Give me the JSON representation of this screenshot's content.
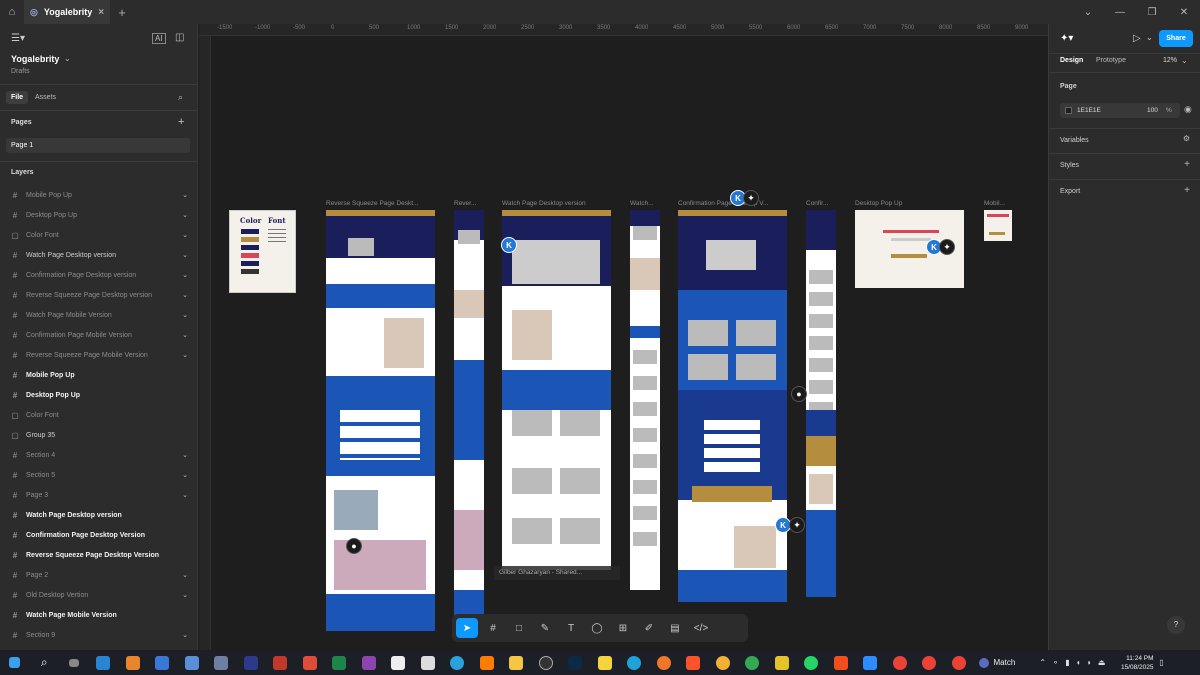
{
  "tabbar": {
    "tab_title": "Yogalebrity",
    "close": "×",
    "new_tab": "+",
    "window": [
      "—",
      "❐",
      "✕"
    ],
    "min_label": "⌄"
  },
  "left_panel": {
    "project": "Yogalebrity",
    "subtitle": "Drafts",
    "tab_file": "File",
    "tab_assets": "Assets",
    "pages_label": "Pages",
    "page_item": "Page 1",
    "layers_label": "Layers",
    "layers": [
      {
        "name": "Mobile Pop Up",
        "type": "frame",
        "style": "dim",
        "chev": true
      },
      {
        "name": "Desktop Pop Up",
        "type": "frame",
        "style": "dim",
        "chev": true
      },
      {
        "name": "Color Font",
        "type": "box",
        "style": "dim",
        "chev": true
      },
      {
        "name": "Watch Page Desktop version",
        "type": "frame",
        "style": "normal",
        "chev": true
      },
      {
        "name": "Confirmation Page Desktop version",
        "type": "frame",
        "style": "dim",
        "chev": true
      },
      {
        "name": "Reverse Squeeze Page Desktop version",
        "type": "frame",
        "style": "dim",
        "chev": true
      },
      {
        "name": "Watch  Page  Mobile Version",
        "type": "frame",
        "style": "dim",
        "chev": true
      },
      {
        "name": "Confirmation  Page  Mobile Version",
        "type": "frame",
        "style": "dim",
        "chev": true
      },
      {
        "name": "Reverse Squeeze Page  Mobile Version",
        "type": "frame",
        "style": "dim",
        "chev": true
      },
      {
        "name": "Mobile Pop Up",
        "type": "frame",
        "style": "bold",
        "chev": false
      },
      {
        "name": "Desktop Pop Up",
        "type": "frame",
        "style": "bold",
        "chev": false
      },
      {
        "name": "Color Font",
        "type": "box",
        "style": "dim",
        "chev": false
      },
      {
        "name": "Group 35",
        "type": "box",
        "style": "normal",
        "chev": false
      },
      {
        "name": "Section 4",
        "type": "frame",
        "style": "dim",
        "chev": true
      },
      {
        "name": "Section 5",
        "type": "frame",
        "style": "dim",
        "chev": true
      },
      {
        "name": "Page 3",
        "type": "frame",
        "style": "dim",
        "chev": true
      },
      {
        "name": "Watch Page Desktop version",
        "type": "frame",
        "style": "bold",
        "chev": false
      },
      {
        "name": "Confirmation Page  Desktop Version",
        "type": "frame",
        "style": "bold",
        "chev": false
      },
      {
        "name": "Reverse Squeeze Page  Desktop Version",
        "type": "frame",
        "style": "bold",
        "chev": false
      },
      {
        "name": "Page 2",
        "type": "frame",
        "style": "dim",
        "chev": true
      },
      {
        "name": "Old Desktop Vertion",
        "type": "frame",
        "style": "dim",
        "chev": true
      },
      {
        "name": "Watch  Page  Mobile Version",
        "type": "frame",
        "style": "bold",
        "chev": false
      },
      {
        "name": "Section 9",
        "type": "frame",
        "style": "dim",
        "chev": true
      }
    ]
  },
  "right_panel": {
    "share": "Share",
    "tab_design": "Design",
    "tab_prototype": "Prototype",
    "zoom": "12%",
    "page_label": "Page",
    "page_color": "1E1E1E",
    "page_opacity": "100",
    "percent": "%",
    "variables": "Variables",
    "styles": "Styles",
    "export": "Export",
    "help": "?"
  },
  "canvas": {
    "ruler_ticks": [
      "-1500",
      "-1000",
      "-500",
      "0",
      "500",
      "1000",
      "1500",
      "2000",
      "2500",
      "3000",
      "3500",
      "4000",
      "4500",
      "5000",
      "5500",
      "6000",
      "6500",
      "7000",
      "7500",
      "8000",
      "8500",
      "9000"
    ],
    "frame_labels": [
      "Reverse Squeeze Page  Deskt...",
      "Rever...",
      "Watch Page Desktop version",
      "Watch...",
      "Confirmation  Page Desktop V...",
      "Confir...",
      "Desktop Pop Up",
      "Mobil..."
    ],
    "color_font": {
      "color": "Color",
      "font": "Font"
    },
    "collab_k": "K",
    "tooltip": "Gilber Ghazaryan - Shared..."
  },
  "taskbar": {
    "search_label": "Match",
    "time": "11:24 PM",
    "date": "15/08/2025"
  },
  "colors": {
    "accent": "#0d99ff",
    "navy": "#1a1f5c",
    "gold": "#b48e3e",
    "blue": "#1b55b5"
  }
}
